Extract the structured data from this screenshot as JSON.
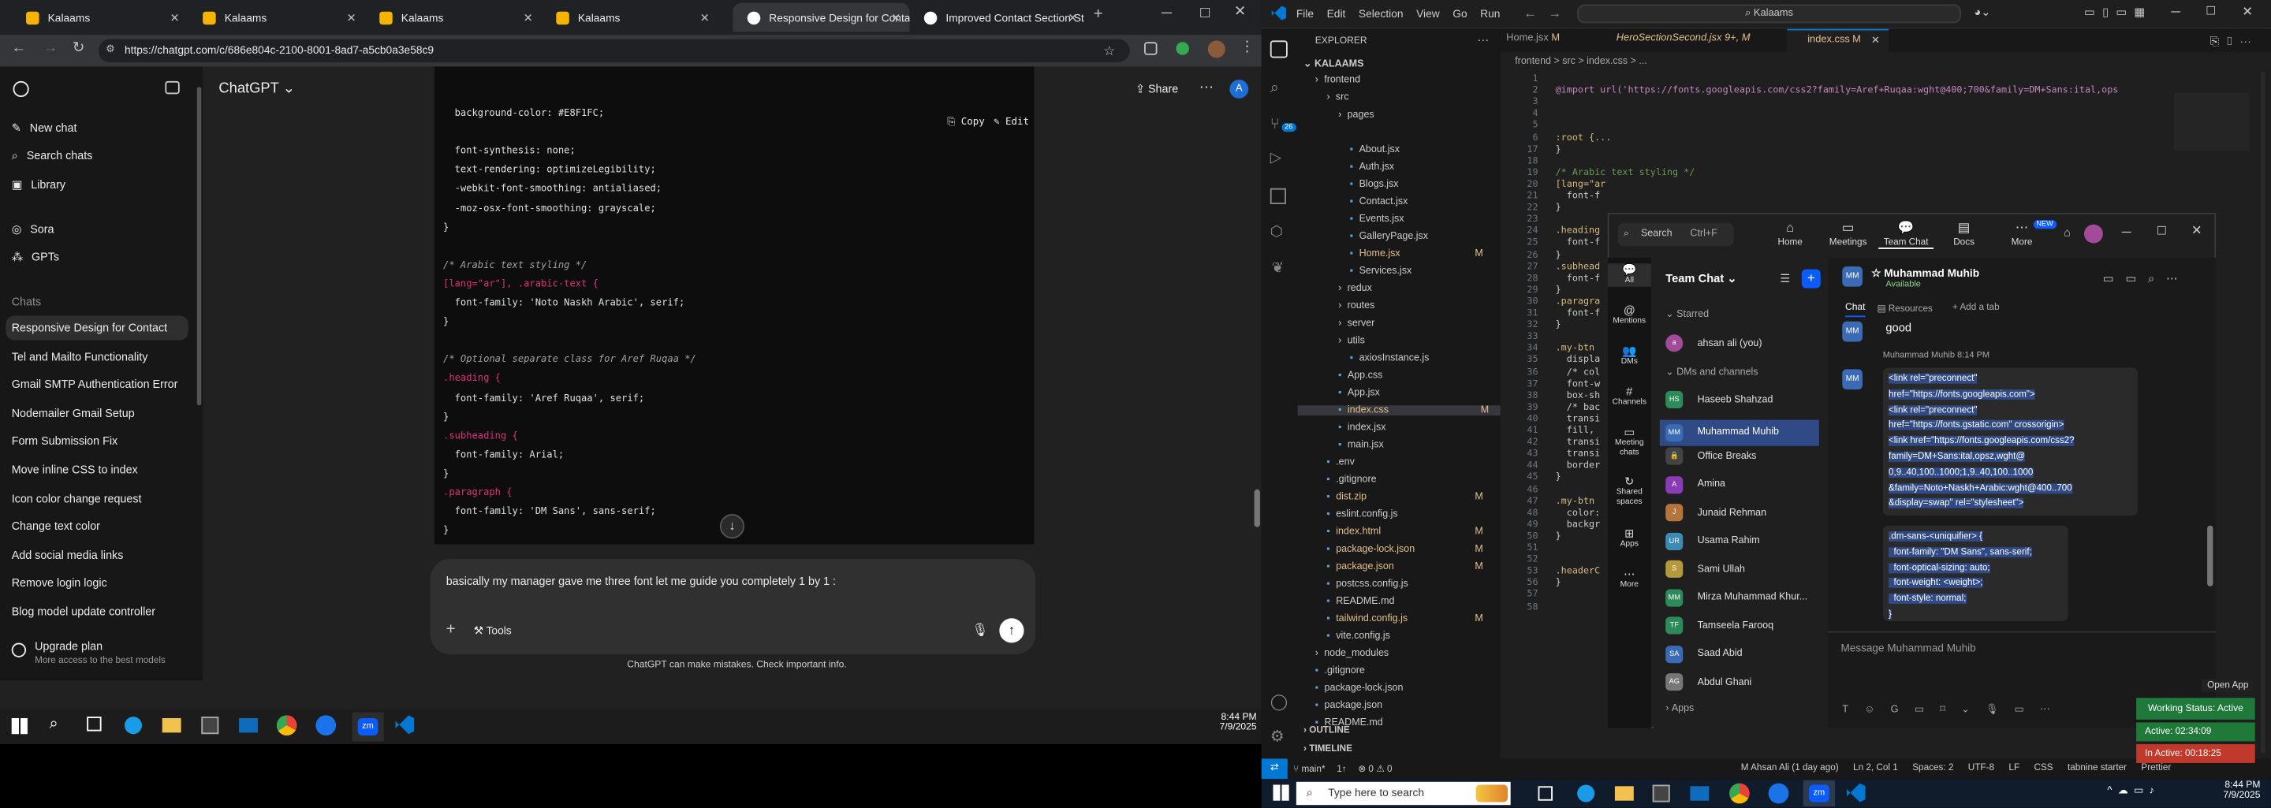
{
  "browser": {
    "tabs": [
      {
        "label": "Kalaams"
      },
      {
        "label": "Kalaams"
      },
      {
        "label": "Kalaams"
      },
      {
        "label": "Kalaams"
      },
      {
        "label": "Responsive Design for Conta"
      },
      {
        "label": "Improved Contact Section St"
      }
    ],
    "url": "https://chatgpt.com/c/686e804c-2100-8001-8ad7-a5cb0a3e58c9"
  },
  "chatgpt": {
    "title": "ChatGPT",
    "share": "Share",
    "avatar": "A",
    "sidebar": {
      "new_chat": "New chat",
      "search": "Search chats",
      "library": "Library",
      "sora": "Sora",
      "gpts": "GPTs",
      "chats_header": "Chats",
      "chats": [
        "Responsive Design for Contact",
        "Tel and Mailto Functionality",
        "Gmail SMTP Authentication Error",
        "Nodemailer Gmail Setup",
        "Form Submission Fix",
        "Move inline CSS to index",
        "Icon color change request",
        "Change text color",
        "Add social media links",
        "Remove login logic",
        "Blog model update controller"
      ],
      "upgrade": "Upgrade plan",
      "upgrade_sub": "More access to the best models"
    },
    "code_actions": {
      "copy": "Copy",
      "edit": "Edit"
    },
    "code_lines": [
      {
        "t": "  background-color: #E8F1FC;",
        "cls": ""
      },
      {
        "t": "",
        "cls": ""
      },
      {
        "t": "  font-synthesis: none;",
        "cls": ""
      },
      {
        "t": "  text-rendering: optimizeLegibility;",
        "cls": ""
      },
      {
        "t": "  -webkit-font-smoothing: antialiased;",
        "cls": ""
      },
      {
        "t": "  -moz-osx-font-smoothing: grayscale;",
        "cls": ""
      },
      {
        "t": "}",
        "cls": ""
      },
      {
        "t": "",
        "cls": ""
      },
      {
        "t": "/* Arabic text styling */",
        "cls": "c"
      },
      {
        "t": "[lang=\"ar\"], .arabic-text {",
        "cls": "k"
      },
      {
        "t": "  font-family: 'Noto Naskh Arabic', serif;",
        "cls": ""
      },
      {
        "t": "}",
        "cls": ""
      },
      {
        "t": "",
        "cls": ""
      },
      {
        "t": "/* Optional separate class for Aref Ruqaa */",
        "cls": "c"
      },
      {
        "t": ".heading {",
        "cls": "k"
      },
      {
        "t": "  font-family: 'Aref Ruqaa', serif;",
        "cls": ""
      },
      {
        "t": "}",
        "cls": ""
      },
      {
        "t": ".subheading {",
        "cls": "k"
      },
      {
        "t": "  font-family: Arial;",
        "cls": ""
      },
      {
        "t": "}",
        "cls": ""
      },
      {
        "t": ".paragraph {",
        "cls": "k"
      },
      {
        "t": "  font-family: 'DM Sans', sans-serif;",
        "cls": ""
      },
      {
        "t": "}",
        "cls": ""
      }
    ],
    "composer_text": "basically my manager gave me three font let me guide you completely 1 by 1 :",
    "tools": "Tools",
    "disclaimer": "ChatGPT can make mistakes. Check important info."
  },
  "taskbar_left": {
    "time": "8:44 PM",
    "date": "7/9/2025"
  },
  "vscode": {
    "menu": [
      "File",
      "Edit",
      "Selection",
      "View",
      "Go",
      "Run"
    ],
    "search": "Kalaams",
    "tabs": [
      {
        "label": "Home.jsx",
        "mod": "M"
      },
      {
        "label": "HeroSectionSecond.jsx",
        "mod": "9+, M"
      },
      {
        "label": "index.css",
        "mod": "M"
      }
    ],
    "breadcrumb": "frontend > src > index.css > ...",
    "explorer_title": "EXPLORER",
    "root": "KALAAMS",
    "files": [
      {
        "n": "frontend",
        "d": 1,
        "folder": true
      },
      {
        "n": "src",
        "d": 2,
        "folder": true
      },
      {
        "n": "pages",
        "d": 3,
        "folder": true
      },
      {
        "n": "About.jsx",
        "d": 4
      },
      {
        "n": "Auth.jsx",
        "d": 4
      },
      {
        "n": "Blogs.jsx",
        "d": 4
      },
      {
        "n": "Contact.jsx",
        "d": 4
      },
      {
        "n": "Events.jsx",
        "d": 4
      },
      {
        "n": "GalleryPage.jsx",
        "d": 4
      },
      {
        "n": "Home.jsx",
        "d": 4,
        "m": "M"
      },
      {
        "n": "Services.jsx",
        "d": 4
      },
      {
        "n": "redux",
        "d": 3,
        "folder": true
      },
      {
        "n": "routes",
        "d": 3,
        "folder": true
      },
      {
        "n": "server",
        "d": 3,
        "folder": true
      },
      {
        "n": "utils",
        "d": 3,
        "folder": true
      },
      {
        "n": "axiosInstance.js",
        "d": 4
      },
      {
        "n": "App.css",
        "d": 3
      },
      {
        "n": "App.jsx",
        "d": 3
      },
      {
        "n": "index.css",
        "d": 3,
        "m": "M",
        "sel": true
      },
      {
        "n": "index.jsx",
        "d": 3
      },
      {
        "n": "main.jsx",
        "d": 3
      },
      {
        "n": ".env",
        "d": 2
      },
      {
        "n": ".gitignore",
        "d": 2
      },
      {
        "n": "dist.zip",
        "d": 2,
        "m": "M"
      },
      {
        "n": "eslint.config.js",
        "d": 2
      },
      {
        "n": "index.html",
        "d": 2,
        "m": "M"
      },
      {
        "n": "package-lock.json",
        "d": 2,
        "m": "M"
      },
      {
        "n": "package.json",
        "d": 2,
        "m": "M"
      },
      {
        "n": "postcss.config.js",
        "d": 2
      },
      {
        "n": "README.md",
        "d": 2
      },
      {
        "n": "tailwind.config.js",
        "d": 2,
        "m": "M"
      },
      {
        "n": "vite.config.js",
        "d": 2
      },
      {
        "n": "node_modules",
        "d": 1,
        "folder": true
      },
      {
        "n": ".gitignore",
        "d": 1
      },
      {
        "n": "package-lock.json",
        "d": 1
      },
      {
        "n": "package.json",
        "d": 1
      },
      {
        "n": "README.md",
        "d": 1
      }
    ],
    "outline": "OUTLINE",
    "timeline": "TIMELINE",
    "editor_lines": [
      {
        "n": "1",
        "t": ""
      },
      {
        "n": "2",
        "t": "@import url('https://fonts.googleapis.com/css2?family=Aref+Ruqaa:wght@400;700&family=DM+Sans:ital,ops"
      },
      {
        "n": "3",
        "t": ""
      },
      {
        "n": "4",
        "t": ""
      },
      {
        "n": "5",
        "t": ""
      },
      {
        "n": "6",
        "t": ":root {..."
      },
      {
        "n": "17",
        "t": "}"
      },
      {
        "n": "18",
        "t": ""
      },
      {
        "n": "19",
        "t": "/* Arabic text styling */"
      },
      {
        "n": "20",
        "t": "[lang=\"ar"
      },
      {
        "n": "21",
        "t": "  font-f"
      },
      {
        "n": "22",
        "t": "}"
      },
      {
        "n": "23",
        "t": ""
      },
      {
        "n": "24",
        "t": ".heading"
      },
      {
        "n": "25",
        "t": "  font-f"
      },
      {
        "n": "26",
        "t": "}"
      },
      {
        "n": "27",
        "t": ".subhead"
      },
      {
        "n": "28",
        "t": "  font-f"
      },
      {
        "n": "29",
        "t": "}"
      },
      {
        "n": "30",
        "t": ".paragra"
      },
      {
        "n": "31",
        "t": "  font-f"
      },
      {
        "n": "32",
        "t": "}"
      },
      {
        "n": "33",
        "t": ""
      },
      {
        "n": "34",
        "t": ".my-btn"
      },
      {
        "n": "35",
        "t": "  displa"
      },
      {
        "n": "36",
        "t": "  /* col"
      },
      {
        "n": "37",
        "t": "  font-w"
      },
      {
        "n": "38",
        "t": "  box-sh"
      },
      {
        "n": "39",
        "t": "  /* bac"
      },
      {
        "n": "40",
        "t": "  transi"
      },
      {
        "n": "41",
        "t": "  fill,"
      },
      {
        "n": "42",
        "t": "  transi"
      },
      {
        "n": "43",
        "t": "  transi"
      },
      {
        "n": "44",
        "t": "  border"
      },
      {
        "n": "45",
        "t": "}"
      },
      {
        "n": "46",
        "t": ""
      },
      {
        "n": "47",
        "t": ".my-btn"
      },
      {
        "n": "48",
        "t": "  color:"
      },
      {
        "n": "49",
        "t": "  backgr"
      },
      {
        "n": "50",
        "t": "}"
      },
      {
        "n": "51",
        "t": ""
      },
      {
        "n": "52",
        "t": ""
      },
      {
        "n": "53",
        "t": ".headerC"
      },
      {
        "n": "56",
        "t": "}"
      },
      {
        "n": "57",
        "t": ""
      },
      {
        "n": "58",
        "t": ""
      }
    ],
    "status": {
      "branch": "main*",
      "sync": "1↑",
      "problems": "⊗ 0 ⚠ 0",
      "author": "M Ahsan Ali (1 day ago)",
      "pos": "Ln 2, Col 1",
      "spaces": "Spaces: 2",
      "enc": "UTF-8",
      "eol": "LF",
      "lang": "CSS",
      "tabnine": "tabnine starter",
      "prettier": "Prettier"
    }
  },
  "teams": {
    "search": "Search",
    "shortcut": "Ctrl+F",
    "nav": [
      {
        "label": "Home"
      },
      {
        "label": "Meetings"
      },
      {
        "label": "Team Chat"
      },
      {
        "label": "Docs"
      },
      {
        "label": "More"
      }
    ],
    "new_badge": "NEW",
    "rail": [
      "All",
      "Mentions",
      "DMs",
      "Channels",
      "Meeting chats",
      "Shared spaces",
      "Apps",
      "More"
    ],
    "list_title": "Team Chat",
    "starred": "Starred",
    "me": "ahsan ali (you)",
    "dms_header": "DMs and channels",
    "contacts": [
      {
        "n": "Haseeb Shahzad",
        "i": "HS",
        "c": "#2d8a5a"
      },
      {
        "n": "Muhammad Muhib",
        "i": "MM",
        "c": "#3b6bb5",
        "sel": true
      },
      {
        "n": "Office Breaks",
        "i": "🔒",
        "c": "#444"
      },
      {
        "n": "Amina",
        "i": "A",
        "c": "#8b3bb5"
      },
      {
        "n": "Junaid Rehman",
        "i": "J",
        "c": "#b5743b"
      },
      {
        "n": "Usama Rahim",
        "i": "UR",
        "c": "#3b8bb5"
      },
      {
        "n": "Sami Ullah",
        "i": "S",
        "c": "#b59a3b"
      },
      {
        "n": "Mirza Muhammad Khur...",
        "i": "MM",
        "c": "#2d8a5a"
      },
      {
        "n": "Tamseela Farooq",
        "i": "TF",
        "c": "#2d8a5a"
      },
      {
        "n": "Saad Abid",
        "i": "SA",
        "c": "#3b6bb5"
      },
      {
        "n": "Abdul Ghani",
        "i": "AG",
        "c": "#777"
      }
    ],
    "apps": "Apps",
    "contact_name": "Muhammad Muhib",
    "contact_status": "Available",
    "chat_tabs": [
      "Chat",
      "Resources",
      "Add a tab"
    ],
    "prev_msg": "good",
    "sender": "Muhammad Muhib",
    "time": "8:14 PM",
    "msg_lines": [
      "<link rel=\"preconnect\"",
      "href=\"https://fonts.googleapis.com\">",
      "<link rel=\"preconnect\"",
      "href=\"https://fonts.gstatic.com\" crossorigin>",
      "<link href=\"https://fonts.googleapis.com/css2?",
      "family=DM+Sans:ital,opsz,wght@",
      "0,9..40,100..1000;1,9..40,100..1000",
      "&family=Noto+Naskh+Arabic:wght@400..700",
      "&display=swap\" rel=\"stylesheet\">"
    ],
    "msg2_lines": [
      ".dm-sans-<uniquifier> {",
      "  font-family: \"DM Sans\", sans-serif;",
      "  font-optical-sizing: auto;",
      "  font-weight: <weight>;",
      "  font-style: normal;",
      "}"
    ],
    "placeholder": "Message Muhammad Muhib",
    "open_app": "Open App",
    "working": "Working Status: Active",
    "active": "Active: 02:34:09",
    "inactive": "In Active: 00:18:25"
  },
  "win_taskbar": {
    "search": "Type here to search",
    "time": "8:44 PM",
    "date": "7/9/2025"
  }
}
